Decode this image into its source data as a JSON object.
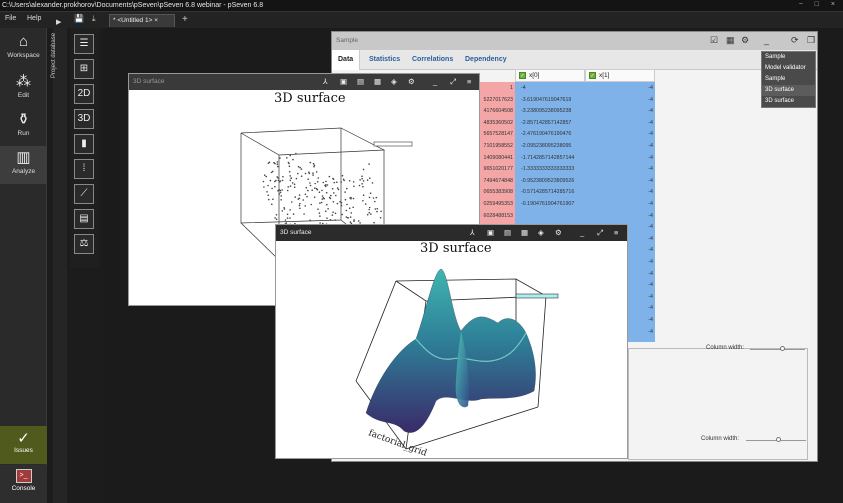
{
  "window": {
    "title": "C:\\Users\\alexander.prokhorov\\Documents\\pSeven\\pSeven 6.8 webinar - pSeven 6.8",
    "controls": "− □ ×"
  },
  "menu": {
    "file": "File",
    "help": "Help"
  },
  "tab": {
    "label": "* <Untitled 1>"
  },
  "sidebar": {
    "workspace": "Workspace",
    "edit": "Edit",
    "run": "Run",
    "analyze": "Analyze",
    "issues": "Issues",
    "console": "Console"
  },
  "project_database_label": "Project database",
  "tools": [
    "☰",
    "⊞",
    "2D",
    "3D",
    "▮",
    "⁞",
    "⟋",
    "▤",
    "⚖"
  ],
  "sample": {
    "title": "Sample",
    "tabs": [
      "Data",
      "Statistics",
      "Correlations",
      "Dependency"
    ],
    "dropdown": [
      "Sample",
      "Model validator",
      "Sample",
      "3D surface",
      "3D surface"
    ],
    "columns": [
      "x[0]",
      "x[1]"
    ],
    "red_col": [
      "1",
      "5227017623",
      "4176604508",
      "4835360502",
      "5657528147",
      "7101958552",
      "1409080441",
      "9651020177",
      "7494674848",
      "0655383908",
      "0259495353",
      "6028488153"
    ],
    "x0": [
      "-4",
      "-3.619047619047619",
      "-3.238095238095238",
      "-2.857142857142857",
      "-2.476190476190476",
      "-2.095238095238095",
      "-1.7142857142857144",
      "-1.3333333333333333",
      "-0.9523809523809526",
      "-0.5714285714285716",
      "-0.1904761904761907"
    ],
    "x1": [
      "-4",
      "-4",
      "-4",
      "-4",
      "-4",
      "-4",
      "-4",
      "-4",
      "-4",
      "-4",
      "-4",
      "-4",
      "-4",
      "-4",
      "-4",
      "-4",
      "-4",
      "-4",
      "-4",
      "-4",
      "-4",
      "-4"
    ],
    "column_width": "Column width:"
  },
  "plot_back": {
    "window_title": "3D surface",
    "plot_title": "3D surface"
  },
  "plot_front": {
    "window_title": "3D surface",
    "plot_title": "3D surface",
    "axis_label": "factorial_grid"
  },
  "accent": {
    "issues_bg": "#4f5a1c",
    "red_col": "#f4a6a6",
    "blue_col": "#7eb2e8",
    "link": "#2a5f9a"
  }
}
